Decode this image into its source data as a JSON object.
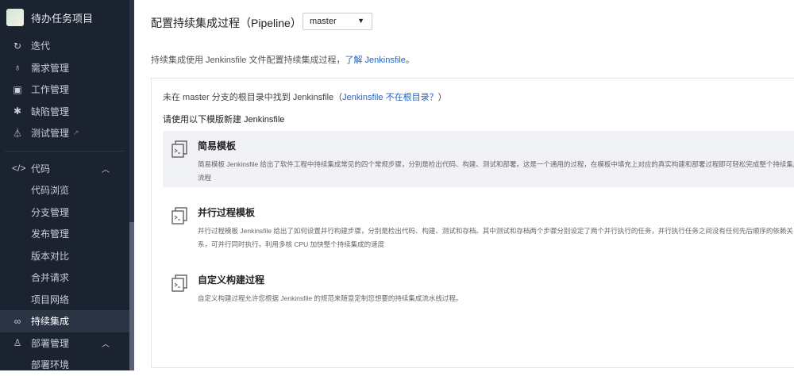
{
  "sidebar": {
    "project": "待办任务项目",
    "items": [
      {
        "label": "迭代",
        "icon": "iteration-icon"
      },
      {
        "label": "需求管理",
        "icon": "lightbulb-icon"
      },
      {
        "label": "工作管理",
        "icon": "board-icon"
      },
      {
        "label": "缺陷管理",
        "icon": "bug-icon"
      },
      {
        "label": "测试管理",
        "icon": "flask-icon"
      }
    ],
    "code": {
      "label": "代码",
      "sub": [
        "代码浏览",
        "分支管理",
        "发布管理",
        "版本对比",
        "合并请求",
        "项目网络"
      ]
    },
    "ci": "持续集成",
    "deploy": {
      "label": "部署管理",
      "sub": [
        "部署环境"
      ]
    }
  },
  "main": {
    "title": "配置持续集成过程（Pipeline）",
    "branch": "master",
    "desc": "持续集成使用 Jenkinsfile 文件配置持续集成过程，",
    "desc_link": "了解 Jenkinsfile",
    "desc_end": "。",
    "notfound": "未在 master 分支的根目录中找到 Jenkinsfile（",
    "notfound_link": "Jenkinsfile 不在根目录？",
    "notfound_end": "）",
    "use": "请使用以下模版新建 Jenkinsfile",
    "templates": [
      {
        "title": "简易模板",
        "text": "简易模板 Jenkinsfile 给出了软件工程中持续集成常见的四个常规步骤，分别是检出代码、构建、测试和部署。这是一个通用的过程，在模板中填充上对应的真实构建和部署过程即可轻松完成整个持续集成流程"
      },
      {
        "title": "并行过程模板",
        "text": "并行过程模板 Jenkinsfile 给出了如何设置并行构建步骤，分别是检出代码、构建、测试和存档。其中测试和存档两个步骤分别设定了两个并行执行的任务，并行执行任务之间没有任何先后顺序的依赖关系，可并行同时执行，利用多核 CPU 加快整个持续集成的速度"
      },
      {
        "title": "自定义构建过程",
        "text": "自定义构建过程允许您根据 Jenkinsfile 的规范来随意定制您想要的持续集成流水线过程。"
      }
    ]
  }
}
